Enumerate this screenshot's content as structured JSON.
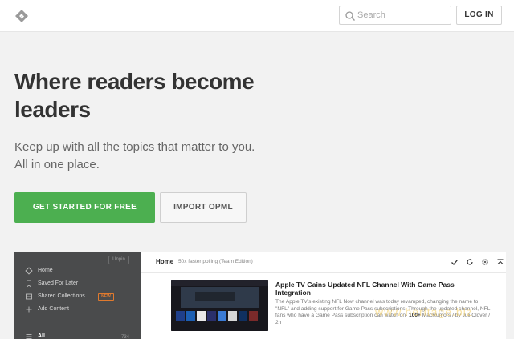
{
  "header": {
    "search_placeholder": "Search",
    "login_label": "LOG IN"
  },
  "hero": {
    "title": "Where readers become leaders",
    "subtitle_line1": "Keep up with all the topics that matter to you.",
    "subtitle_line2": "All in one place.",
    "primary_button": "GET STARTED FOR FREE",
    "secondary_button": "IMPORT OPML"
  },
  "preview": {
    "sidebar": {
      "unpin_label": "Unpin",
      "items": [
        {
          "label": "Home",
          "icon": "home-icon"
        },
        {
          "label": "Saved For Later",
          "icon": "bookmark-icon"
        },
        {
          "label": "Shared Collections",
          "icon": "shared-icon",
          "badge": "NEW"
        },
        {
          "label": "Add Content",
          "icon": "plus-icon"
        },
        {
          "label": "All",
          "icon": "list-icon",
          "count": "734"
        }
      ]
    },
    "feed": {
      "title": "Home",
      "subtitle": "50x faster polling (Team Edition)",
      "tools": [
        "check-icon",
        "refresh-icon",
        "gear-icon",
        "collapse-icon"
      ]
    },
    "article": {
      "title": "Apple TV Gains Updated NFL Channel With Game Pass Integration",
      "body": "The Apple TV's existing NFL Now channel was today revamped, changing the name to \"NFL\" and adding support for Game Pass subscriptions. Through the updated channel, NFL fans who have a Game Pass subscription can watch on-",
      "count": "100+",
      "meta": "MacRumors / by Juli Clover / 2h"
    }
  },
  "watermark": "www.heritage.biz",
  "colors": {
    "primary_green": "#4caf50",
    "sidebar_bg": "#4a4b4c",
    "new_badge": "#e07a2e"
  }
}
